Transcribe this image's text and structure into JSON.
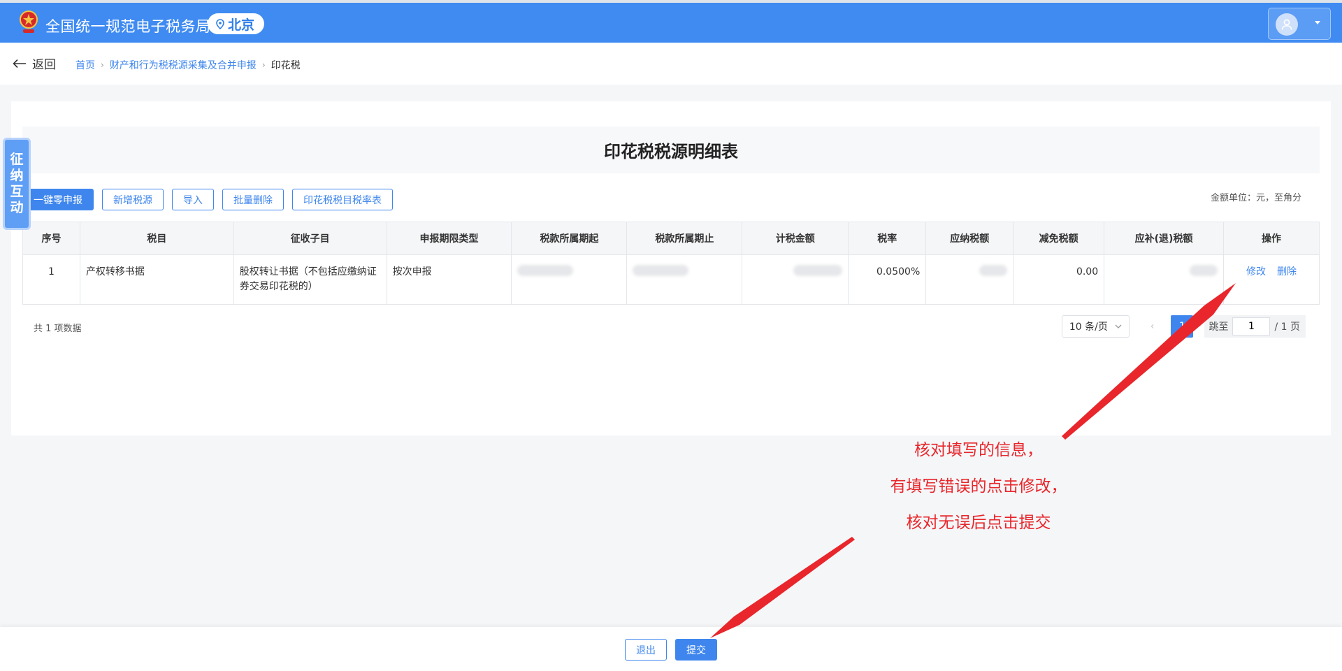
{
  "header": {
    "app_title": "全国统一规范电子税务局",
    "location": "北京"
  },
  "nav": {
    "back_label": "返回",
    "breadcrumb": [
      "首页",
      "财产和行为税税源采集及合并申报",
      "印花税"
    ]
  },
  "side_tab": {
    "chars": [
      "征",
      "纳",
      "互",
      "动"
    ]
  },
  "main": {
    "title": "印花税税源明细表",
    "toolbar": [
      "一键零申报",
      "新增税源",
      "导入",
      "批量删除",
      "印花税税目税率表"
    ],
    "unit_note": "金额单位：元，至角分",
    "table": {
      "headers": [
        "序号",
        "税目",
        "征收子目",
        "申报期限类型",
        "税款所属期起",
        "税款所属期止",
        "计税金额",
        "税率",
        "应纳税额",
        "减免税额",
        "应补(退)税额",
        "操作"
      ],
      "rows": [
        {
          "index": "1",
          "item": "产权转移书据",
          "sub_item": "股权转让书据（不包括应缴纳证券交易印花税的）",
          "period_type": "按次申报",
          "tax_rate": "0.0500%",
          "relief": "0.00",
          "actions": [
            "修改",
            "删除"
          ]
        }
      ]
    },
    "total_text": "共 1 项数据",
    "pager": {
      "page_size": "10 条/页",
      "prev": "‹",
      "current_page": "1",
      "jump_label": "跳至",
      "jump_value": "1",
      "total_pages": "/ 1 页"
    }
  },
  "footer": {
    "exit_label": "退出",
    "submit_label": "提交"
  },
  "annotation": {
    "lines": [
      "核对填写的信息，",
      "有填写错误的点击修改，",
      "核对无误后点击提交"
    ],
    "color": "#e8262b"
  },
  "colors": {
    "topbar": "#3f8bf2",
    "accent": "#3e86ee"
  }
}
